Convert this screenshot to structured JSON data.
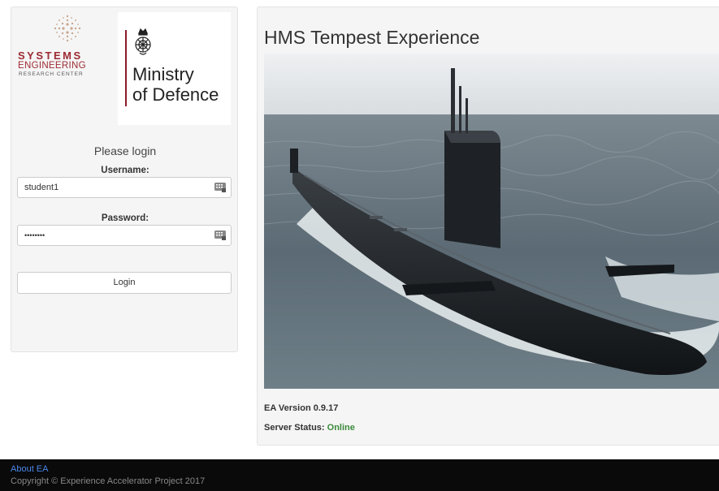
{
  "logos": {
    "ser": {
      "line1": "SYSTEMS",
      "line2": "ENGINEERING",
      "line3": "RESEARCH CENTER"
    },
    "mod": {
      "line1": "Ministry",
      "line2": "of Defence"
    }
  },
  "login": {
    "title": "Please login",
    "username_label": "Username:",
    "username_value": "student1",
    "password_label": "Password:",
    "password_value": "••••••••",
    "login_button": "Login"
  },
  "main": {
    "title": "HMS Tempest Experience",
    "version": "EA Version 0.9.17",
    "status_label": "Server Status:",
    "status_value": "Online"
  },
  "footer": {
    "about_link": "About EA",
    "copyright": "Copyright © Experience Accelerator Project 2017"
  },
  "colors": {
    "ser_red": "#9c2a32",
    "status_online": "#3c8a3c",
    "footer_bg": "#0a0a0a",
    "link_blue": "#4a86e8"
  }
}
